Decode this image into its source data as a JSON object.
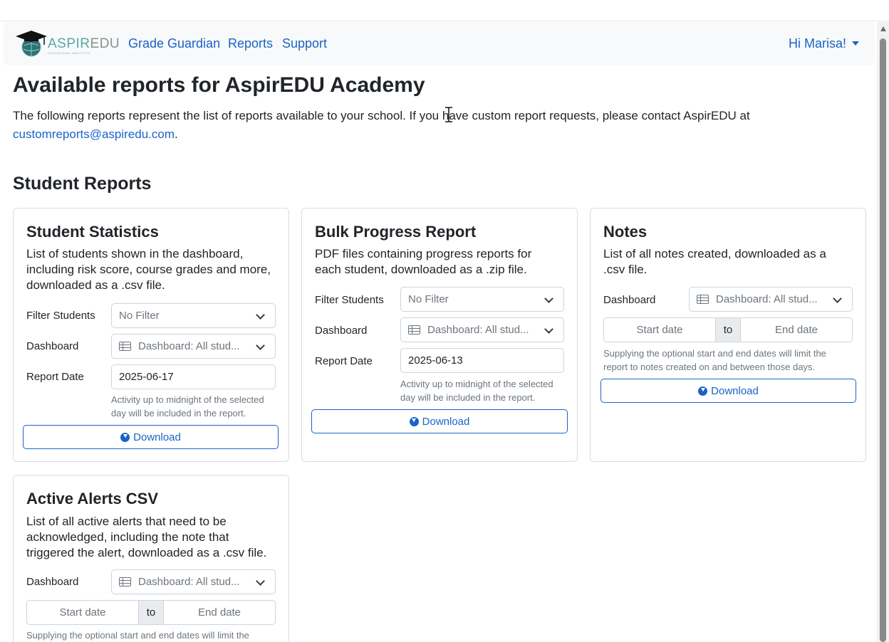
{
  "nav": {
    "brand_prefix": "ASPIR",
    "brand_suffix": "EDU",
    "brand_tagline": "EDUCATIONAL ANALYTICS",
    "links": [
      "Grade Guardian",
      "Reports",
      "Support"
    ],
    "user_greeting": "Hi Marisa!"
  },
  "page": {
    "title": "Available reports for AspirEDU Academy",
    "intro": "The following reports represent the list of reports available to your school. If you have custom report requests, please contact AspirEDU at",
    "email": "customreports@aspiredu.com",
    "intro_end": "."
  },
  "section": {
    "title": "Student Reports"
  },
  "cards": {
    "student_statistics": {
      "title": "Student Statistics",
      "description": "List of students shown in the dashboard, including risk score, course grades and more, downloaded as a .csv file.",
      "filter_label": "Filter Students",
      "filter_value": "No Filter",
      "dashboard_label": "Dashboard",
      "dashboard_value": "Dashboard: All stud...",
      "date_label": "Report Date",
      "date_value": "2025-06-17",
      "help": "Activity up to midnight of the selected day will be included in the report.",
      "button": "Download"
    },
    "bulk_progress": {
      "title": "Bulk Progress Report",
      "description": "PDF files containing progress reports for each student, downloaded as a .zip file.",
      "filter_label": "Filter Students",
      "filter_value": "No Filter",
      "dashboard_label": "Dashboard",
      "dashboard_value": "Dashboard: All stud...",
      "date_label": "Report Date",
      "date_value": "2025-06-13",
      "help": "Activity up to midnight of the selected day will be included in the report.",
      "button": "Download"
    },
    "notes": {
      "title": "Notes",
      "description": "List of all notes created, downloaded as a .csv file.",
      "dashboard_label": "Dashboard",
      "dashboard_value": "Dashboard: All stud...",
      "start_placeholder": "Start date",
      "to": "to",
      "end_placeholder": "End date",
      "help": "Supplying the optional start and end dates will limit the report to notes created on and between those days.",
      "button": "Download"
    },
    "active_alerts": {
      "title": "Active Alerts CSV",
      "description": "List of all active alerts that need to be acknowledged, including the note that triggered the alert, downloaded as a .csv file.",
      "dashboard_label": "Dashboard",
      "dashboard_value": "Dashboard: All stud...",
      "start_placeholder": "Start date",
      "to": "to",
      "end_placeholder": "End date",
      "help": "Supplying the optional start and end dates will limit the"
    }
  },
  "colors": {
    "link": "#1a63c6",
    "brand_teal": "#5aa6a3"
  }
}
